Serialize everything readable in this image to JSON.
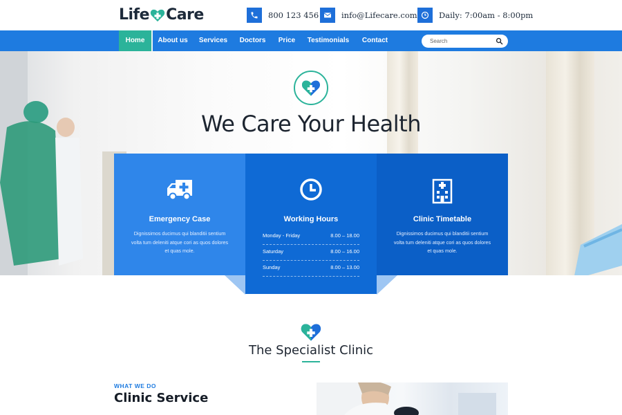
{
  "brand": {
    "logo_left": "Life",
    "logo_right": "Care",
    "accent": "#1e7be0",
    "teal": "#2bb39a"
  },
  "contacts": [
    {
      "icon": "phone-icon",
      "text": "800 123 456"
    },
    {
      "icon": "mail-icon",
      "text": "info@Lifecare.com"
    },
    {
      "icon": "clock-icon",
      "text": "Daily: 7:00am - 8:00pm"
    }
  ],
  "nav": {
    "items": [
      {
        "label": "Home",
        "active": true
      },
      {
        "label": "About us"
      },
      {
        "label": "Services"
      },
      {
        "label": "Doctors"
      },
      {
        "label": "Price"
      },
      {
        "label": "Testimonials"
      },
      {
        "label": "Contact"
      }
    ],
    "search_placeholder": "Search"
  },
  "hero": {
    "title": "We Care Your Health"
  },
  "cards": [
    {
      "icon": "ambulance-icon",
      "title": "Emergency Case",
      "text": "Dignissimos ducimus qui blanditii sentium volta tum deleniti atque cori as quos dolores et quas mole."
    },
    {
      "icon": "clock-icon",
      "title": "Working Hours",
      "hours": [
        {
          "day": "Monday - Friday",
          "time": "8.00 – 18.00"
        },
        {
          "day": "Saturday",
          "time": "8.00 – 16.00"
        },
        {
          "day": "Sunday",
          "time": "8.00 – 13.00"
        }
      ]
    },
    {
      "icon": "hospital-icon",
      "title": "Clinic Timetable",
      "text": "Dignissimos ducimus qui blanditii sentium volta tum deleniti atque cori as quos dolores et quas mole."
    }
  ],
  "specialist": {
    "title": "The Specialist Clinic"
  },
  "service": {
    "label": "WHAT WE DO",
    "heading": "Clinic Service"
  }
}
